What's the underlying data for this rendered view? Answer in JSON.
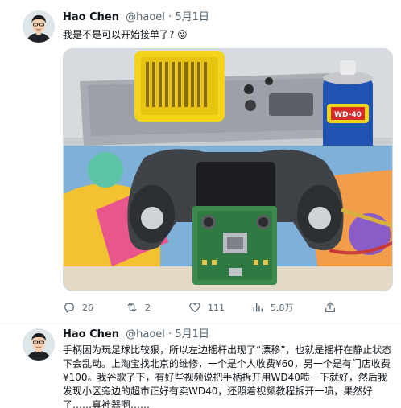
{
  "tweets": [
    {
      "author_name": "Hao Chen",
      "author_handle": "@haoel",
      "separator": "·",
      "date": "5月1日",
      "text": "我是不是可以开始接单了? 😜",
      "avatar_icon": "user-avatar",
      "media_icon": "photo-game-controller-repair",
      "stats": {
        "replies": "26",
        "retweets": "2",
        "likes": "111",
        "views": "5.8万"
      }
    },
    {
      "author_name": "Hao Chen",
      "author_handle": "@haoel",
      "separator": "·",
      "date": "5月1日",
      "text": "手柄因为玩足球比较狠，所以左边摇杆出现了“漂移”，也就是摇杆在静止状态下会乱动。上淘宝找北京的维修，一个是个人收费¥60，另一个是有门店收费¥100。我谷歌了下，有好些视频说把手柄拆开用WD40喷一下就好，然后我发现小区旁边的超市正好有卖WD40，还照着视频教程拆开一喷，果然好了……真神器啊……",
      "avatar_icon": "user-avatar"
    }
  ],
  "colors": {
    "text_primary": "#0f1419",
    "text_secondary": "#536471",
    "border": "#cfd9de"
  },
  "icons": [
    "reply-icon",
    "retweet-icon",
    "like-icon",
    "views-icon",
    "share-icon"
  ]
}
